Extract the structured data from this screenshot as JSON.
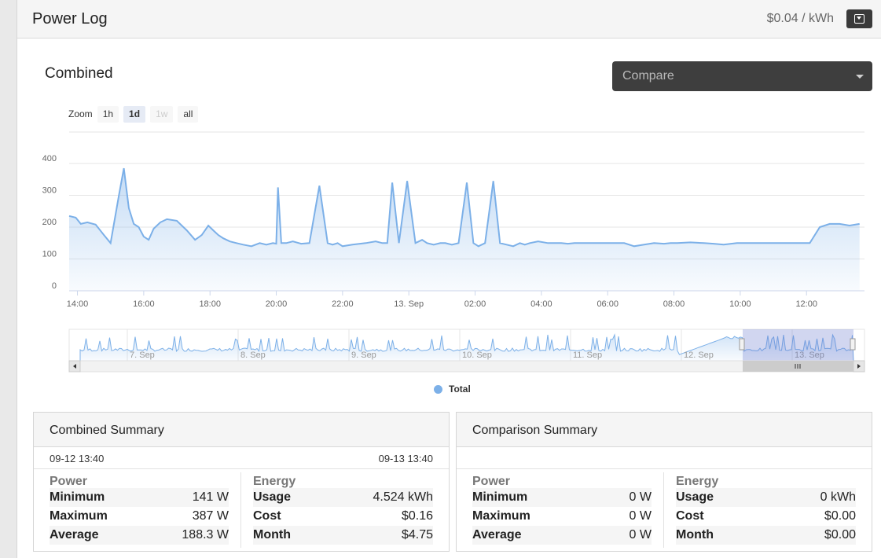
{
  "header": {
    "title": "Power Log",
    "rate": "$0.04 / kWh",
    "menu_icon": "dropdown-square-icon"
  },
  "chart_section": {
    "title": "Combined",
    "compare": {
      "value": "Compare"
    },
    "zoom": {
      "label": "Zoom",
      "buttons": [
        {
          "label": "1h",
          "state": "normal"
        },
        {
          "label": "1d",
          "state": "active"
        },
        {
          "label": "1w",
          "state": "disabled"
        },
        {
          "label": "all",
          "state": "normal"
        }
      ]
    }
  },
  "chart_data": {
    "type": "area",
    "series": [
      {
        "name": "Total",
        "color": "#7cb0e8",
        "x_hours": [
          13.75,
          13.95,
          14.1,
          14.3,
          14.55,
          14.8,
          15.0,
          15.25,
          15.4,
          15.55,
          15.7,
          15.85,
          16.0,
          16.15,
          16.3,
          16.5,
          16.7,
          17.0,
          17.3,
          17.55,
          17.75,
          17.95,
          18.1,
          18.25,
          18.4,
          18.6,
          18.8,
          19.0,
          19.25,
          19.5,
          19.7,
          19.9,
          20.0,
          20.05,
          20.15,
          20.3,
          20.5,
          20.75,
          21.0,
          21.3,
          21.55,
          21.7,
          21.85,
          22.0,
          22.3,
          22.7,
          23.0,
          23.2,
          23.35,
          23.5,
          23.7,
          23.95,
          24.2,
          24.4,
          24.55,
          24.75,
          24.95,
          25.1,
          25.3,
          25.5,
          25.75,
          25.95,
          26.1,
          26.3,
          26.55,
          26.75,
          26.95,
          27.15,
          27.35,
          27.5,
          27.65,
          27.9,
          28.2,
          28.4,
          28.6,
          28.8,
          29.0,
          29.2,
          29.4,
          29.6,
          29.8,
          30.0,
          30.2,
          30.5,
          30.8,
          31.1,
          31.4,
          31.7,
          31.9,
          32.1,
          32.5,
          32.9,
          33.2,
          33.5,
          33.9,
          34.2,
          34.5,
          34.8,
          35.0,
          35.2,
          35.4,
          35.6,
          35.8,
          36.1,
          36.4,
          36.7,
          37.0,
          37.3,
          37.6
        ],
        "y": [
          235,
          230,
          210,
          215,
          208,
          175,
          150,
          300,
          385,
          260,
          210,
          200,
          170,
          160,
          195,
          215,
          225,
          220,
          190,
          160,
          175,
          205,
          190,
          175,
          165,
          155,
          150,
          145,
          140,
          150,
          145,
          150,
          148,
          325,
          150,
          150,
          155,
          148,
          150,
          330,
          150,
          145,
          150,
          140,
          145,
          150,
          155,
          150,
          150,
          340,
          150,
          345,
          150,
          160,
          150,
          145,
          150,
          150,
          145,
          150,
          340,
          150,
          140,
          150,
          345,
          150,
          145,
          140,
          150,
          145,
          150,
          155,
          150,
          150,
          150,
          148,
          150,
          150,
          150,
          150,
          150,
          150,
          150,
          150,
          140,
          145,
          150,
          148,
          150,
          150,
          152,
          150,
          148,
          145,
          150,
          150,
          150,
          150,
          150,
          150,
          150,
          150,
          150,
          150,
          200,
          210,
          210,
          205,
          210
        ]
      }
    ],
    "x_ticks": [
      "14:00",
      "16:00",
      "18:00",
      "20:00",
      "22:00",
      "13. Sep",
      "02:00",
      "04:00",
      "06:00",
      "08:00",
      "10:00",
      "12:00"
    ],
    "y_ticks": [
      0,
      100,
      200,
      300,
      400
    ],
    "ylim": [
      0,
      400
    ],
    "legend": {
      "entries": [
        "Total"
      ],
      "placement": "bottom-center"
    },
    "navigator": {
      "ticks": [
        "7. Sep",
        "8. Sep",
        "9. Sep",
        "10. Sep",
        "11. Sep",
        "12. Sep",
        "13. Sep"
      ]
    }
  },
  "combined_summary": {
    "title": "Combined Summary",
    "start": "09-12 13:40",
    "end": "09-13 13:40",
    "power": {
      "heading": "Power",
      "rows": [
        {
          "label": "Minimum",
          "value": "141 W"
        },
        {
          "label": "Maximum",
          "value": "387 W"
        },
        {
          "label": "Average",
          "value": "188.3 W"
        }
      ]
    },
    "energy": {
      "heading": "Energy",
      "rows": [
        {
          "label": "Usage",
          "value": "4.524 kWh"
        },
        {
          "label": "Cost",
          "value": "$0.16"
        },
        {
          "label": "Month",
          "value": "$4.75"
        }
      ]
    }
  },
  "comparison_summary": {
    "title": "Comparison Summary",
    "start": "",
    "end": "",
    "power": {
      "heading": "Power",
      "rows": [
        {
          "label": "Minimum",
          "value": "0 W"
        },
        {
          "label": "Maximum",
          "value": "0 W"
        },
        {
          "label": "Average",
          "value": "0 W"
        }
      ]
    },
    "energy": {
      "heading": "Energy",
      "rows": [
        {
          "label": "Usage",
          "value": "0 kWh"
        },
        {
          "label": "Cost",
          "value": "$0.00"
        },
        {
          "label": "Month",
          "value": "$0.00"
        }
      ]
    }
  }
}
